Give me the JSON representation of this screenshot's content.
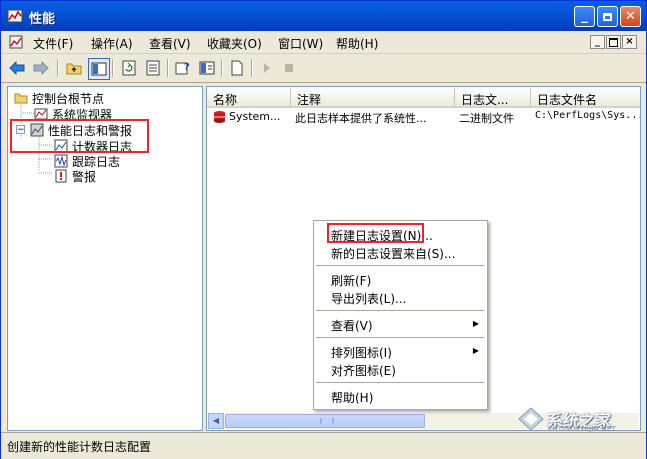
{
  "window": {
    "title": "性能"
  },
  "menubar": {
    "items": [
      "文件(F)",
      "操作(A)",
      "查看(V)",
      "收藏夹(O)",
      "窗口(W)",
      "帮助(H)"
    ]
  },
  "mdi_controls": [
    "_",
    "▫",
    "×"
  ],
  "tree": {
    "root": "控制台根节点",
    "system_monitor": "系统监视器",
    "perf_logs": "性能日志和警报",
    "counter_logs": "计数器日志",
    "trace_logs": "跟踪日志",
    "alerts": "警报"
  },
  "list": {
    "columns": [
      "名称",
      "注释",
      "日志文...",
      "日志文件名"
    ],
    "rows": [
      [
        "System...",
        "此日志样本提供了系统性...",
        "二进制文件",
        "C:\\PerfLogs\\Sys..."
      ]
    ]
  },
  "context_menu": {
    "items": [
      "新建日志设置(N)...",
      "新的日志设置来自(S)...",
      "刷新(F)",
      "导出列表(L)...",
      "查看(V)",
      "排列图标(I)",
      "对齐图标(E)",
      "帮助(H)"
    ]
  },
  "status": {
    "text": "创建新的性能计数日志配置"
  },
  "watermark": {
    "text": "系统之家",
    "sub": "XITONGZHIJIA.NET"
  }
}
